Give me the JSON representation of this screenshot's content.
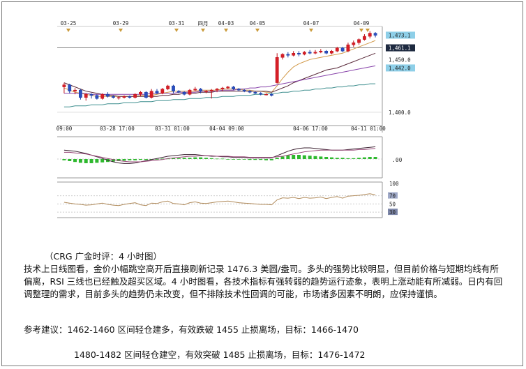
{
  "chart_data": {
    "type": "candlestick",
    "top_axis_labels": [
      "03-25",
      "03-29",
      "03-31",
      "四月",
      "04-03",
      "04-05",
      "04-07",
      "04-09"
    ],
    "bottom_axis_labels": [
      "09:00",
      "03-28 17:00",
      "03-31 01:00",
      "04-04 09:00",
      "04-06 17:00",
      "04-11 01:00"
    ],
    "price_ticks": [
      "1,473.1",
      "1,461.1",
      "1,450.0",
      "1,442.0",
      "1,400.0"
    ],
    "price_badge_colors": [
      "#8ecfe8",
      "#1e2a40",
      "#ffffff",
      "#8ecfe8"
    ],
    "ylim": [
      1390,
      1480
    ],
    "candles": [
      {
        "o": 1424,
        "h": 1428,
        "l": 1418,
        "c": 1426
      },
      {
        "o": 1426,
        "h": 1427,
        "l": 1418,
        "c": 1420
      },
      {
        "o": 1420,
        "h": 1423,
        "l": 1417,
        "c": 1421
      },
      {
        "o": 1421,
        "h": 1422,
        "l": 1412,
        "c": 1414
      },
      {
        "o": 1414,
        "h": 1418,
        "l": 1411,
        "c": 1417
      },
      {
        "o": 1417,
        "h": 1418,
        "l": 1413,
        "c": 1416
      },
      {
        "o": 1416,
        "h": 1417,
        "l": 1412,
        "c": 1413
      },
      {
        "o": 1413,
        "h": 1418,
        "l": 1412,
        "c": 1417
      },
      {
        "o": 1417,
        "h": 1419,
        "l": 1414,
        "c": 1415
      },
      {
        "o": 1415,
        "h": 1416,
        "l": 1413,
        "c": 1414
      },
      {
        "o": 1414,
        "h": 1415,
        "l": 1412,
        "c": 1414
      },
      {
        "o": 1414,
        "h": 1416,
        "l": 1413,
        "c": 1415
      },
      {
        "o": 1415,
        "h": 1416,
        "l": 1413,
        "c": 1414
      },
      {
        "o": 1414,
        "h": 1418,
        "l": 1413,
        "c": 1417
      },
      {
        "o": 1417,
        "h": 1420,
        "l": 1415,
        "c": 1419
      },
      {
        "o": 1419,
        "h": 1420,
        "l": 1413,
        "c": 1414
      },
      {
        "o": 1414,
        "h": 1422,
        "l": 1413,
        "c": 1420
      },
      {
        "o": 1420,
        "h": 1422,
        "l": 1417,
        "c": 1418
      },
      {
        "o": 1418,
        "h": 1423,
        "l": 1417,
        "c": 1422
      },
      {
        "o": 1422,
        "h": 1426,
        "l": 1421,
        "c": 1425
      },
      {
        "o": 1425,
        "h": 1426,
        "l": 1418,
        "c": 1420
      },
      {
        "o": 1420,
        "h": 1421,
        "l": 1418,
        "c": 1419
      },
      {
        "o": 1419,
        "h": 1420,
        "l": 1416,
        "c": 1417
      },
      {
        "o": 1417,
        "h": 1422,
        "l": 1416,
        "c": 1421
      },
      {
        "o": 1421,
        "h": 1424,
        "l": 1420,
        "c": 1422
      },
      {
        "o": 1422,
        "h": 1423,
        "l": 1418,
        "c": 1420
      },
      {
        "o": 1420,
        "h": 1421,
        "l": 1418,
        "c": 1420
      },
      {
        "o": 1420,
        "h": 1422,
        "l": 1413,
        "c": 1421
      },
      {
        "o": 1421,
        "h": 1423,
        "l": 1419,
        "c": 1422
      },
      {
        "o": 1422,
        "h": 1424,
        "l": 1420,
        "c": 1423
      },
      {
        "o": 1423,
        "h": 1425,
        "l": 1422,
        "c": 1424
      },
      {
        "o": 1424,
        "h": 1425,
        "l": 1421,
        "c": 1422
      },
      {
        "o": 1422,
        "h": 1423,
        "l": 1420,
        "c": 1421
      },
      {
        "o": 1421,
        "h": 1422,
        "l": 1419,
        "c": 1420
      },
      {
        "o": 1420,
        "h": 1421,
        "l": 1418,
        "c": 1419
      },
      {
        "o": 1419,
        "h": 1420,
        "l": 1417,
        "c": 1418
      },
      {
        "o": 1418,
        "h": 1419,
        "l": 1416,
        "c": 1417
      },
      {
        "o": 1417,
        "h": 1418,
        "l": 1416,
        "c": 1417
      },
      {
        "o": 1417,
        "h": 1418,
        "l": 1415,
        "c": 1416
      },
      {
        "o": 1428,
        "h": 1456,
        "l": 1427,
        "c": 1452
      },
      {
        "o": 1452,
        "h": 1456,
        "l": 1450,
        "c": 1455
      },
      {
        "o": 1455,
        "h": 1457,
        "l": 1452,
        "c": 1454
      },
      {
        "o": 1454,
        "h": 1458,
        "l": 1453,
        "c": 1456
      },
      {
        "o": 1456,
        "h": 1458,
        "l": 1453,
        "c": 1455
      },
      {
        "o": 1455,
        "h": 1458,
        "l": 1454,
        "c": 1457
      },
      {
        "o": 1457,
        "h": 1459,
        "l": 1455,
        "c": 1456
      },
      {
        "o": 1456,
        "h": 1459,
        "l": 1455,
        "c": 1457
      },
      {
        "o": 1457,
        "h": 1460,
        "l": 1456,
        "c": 1458
      },
      {
        "o": 1458,
        "h": 1459,
        "l": 1455,
        "c": 1456
      },
      {
        "o": 1456,
        "h": 1459,
        "l": 1455,
        "c": 1458
      },
      {
        "o": 1458,
        "h": 1462,
        "l": 1457,
        "c": 1461
      },
      {
        "o": 1461,
        "h": 1462,
        "l": 1457,
        "c": 1458
      },
      {
        "o": 1458,
        "h": 1466,
        "l": 1457,
        "c": 1464
      },
      {
        "o": 1464,
        "h": 1468,
        "l": 1462,
        "c": 1466
      },
      {
        "o": 1466,
        "h": 1470,
        "l": 1464,
        "c": 1469
      },
      {
        "o": 1469,
        "h": 1474,
        "l": 1468,
        "c": 1472
      },
      {
        "o": 1472,
        "h": 1477,
        "l": 1470,
        "c": 1475
      },
      {
        "o": 1475,
        "h": 1476,
        "l": 1471,
        "c": 1473
      }
    ],
    "ma_series": [
      {
        "color": "#d29a4a",
        "values": [
          1423,
          1421,
          1419,
          1418,
          1417,
          1416,
          1415,
          1415,
          1415,
          1415,
          1415,
          1415,
          1415,
          1415,
          1416,
          1416,
          1416,
          1417,
          1418,
          1419,
          1420,
          1420,
          1420,
          1420,
          1420,
          1421,
          1421,
          1421,
          1421,
          1422,
          1422,
          1422,
          1422,
          1421,
          1421,
          1420,
          1420,
          1419,
          1419,
          1425,
          1432,
          1438,
          1443,
          1446,
          1448,
          1450,
          1451,
          1452,
          1453,
          1454,
          1455,
          1456,
          1458,
          1460,
          1462,
          1464,
          1466,
          1468
        ]
      },
      {
        "color": "#5a2a3a",
        "values": [
          1428,
          1426,
          1424,
          1422,
          1420,
          1419,
          1418,
          1417,
          1416,
          1416,
          1415,
          1415,
          1415,
          1415,
          1415,
          1415,
          1415,
          1415,
          1416,
          1416,
          1417,
          1417,
          1418,
          1418,
          1418,
          1419,
          1419,
          1419,
          1420,
          1420,
          1420,
          1420,
          1420,
          1420,
          1420,
          1420,
          1420,
          1420,
          1419,
          1421,
          1423,
          1425,
          1428,
          1430,
          1432,
          1434,
          1436,
          1438,
          1440,
          1441,
          1442,
          1444,
          1446,
          1448,
          1450,
          1452,
          1454,
          1456
        ]
      },
      {
        "color": "#8844aa",
        "values": [
          1418,
          1418,
          1418,
          1418,
          1418,
          1417,
          1417,
          1417,
          1417,
          1417,
          1417,
          1417,
          1417,
          1417,
          1417,
          1417,
          1418,
          1418,
          1418,
          1418,
          1418,
          1419,
          1419,
          1419,
          1419,
          1420,
          1420,
          1420,
          1420,
          1421,
          1421,
          1421,
          1422,
          1422,
          1423,
          1423,
          1424,
          1424,
          1425,
          1426,
          1427,
          1428,
          1429,
          1430,
          1431,
          1432,
          1433,
          1434,
          1435,
          1436,
          1437,
          1438,
          1439,
          1440,
          1441,
          1442,
          1443,
          1444
        ]
      },
      {
        "color": "#3f8f8f",
        "values": [
          1405,
          1405,
          1406,
          1406,
          1406,
          1407,
          1407,
          1407,
          1408,
          1408,
          1408,
          1409,
          1409,
          1409,
          1410,
          1410,
          1410,
          1411,
          1411,
          1411,
          1412,
          1412,
          1412,
          1413,
          1413,
          1413,
          1414,
          1414,
          1414,
          1415,
          1415,
          1415,
          1416,
          1416,
          1416,
          1417,
          1417,
          1417,
          1418,
          1418,
          1419,
          1419,
          1420,
          1420,
          1421,
          1421,
          1422,
          1422,
          1423,
          1423,
          1424,
          1424,
          1425,
          1425,
          1426,
          1426,
          1427,
          1427
        ]
      }
    ],
    "macd_tick": ".00",
    "macd_hist": [
      -0.3,
      -0.5,
      -0.7,
      -0.9,
      -1.0,
      -1.0,
      -0.9,
      -0.8,
      -0.7,
      -0.6,
      -0.5,
      -0.4,
      -0.3,
      -0.3,
      -0.2,
      -0.2,
      -0.1,
      0.0,
      0.1,
      0.1,
      0.2,
      0.2,
      0.3,
      0.3,
      0.4,
      0.4,
      0.3,
      0.2,
      0.1,
      0.1,
      0.0,
      -0.1,
      -0.1,
      -0.1,
      -0.2,
      -0.2,
      -0.2,
      -0.3,
      -0.3,
      0.3,
      0.6,
      0.9,
      1.0,
      1.0,
      0.9,
      0.8,
      0.7,
      0.6,
      0.5,
      0.4,
      0.3,
      0.3,
      0.2,
      0.2,
      0.3,
      0.4,
      0.5,
      0.5
    ],
    "macd_lines": [
      {
        "color": "#3a2030",
        "values": [
          1.6,
          1.5,
          1.4,
          1.2,
          1.0,
          0.7,
          0.4,
          0.1,
          -0.2,
          -0.5,
          -0.7,
          -0.8,
          -0.8,
          -0.7,
          -0.5,
          -0.3,
          -0.1,
          0.1,
          0.3,
          0.5,
          0.6,
          0.7,
          0.8,
          0.8,
          0.8,
          0.7,
          0.6,
          0.5,
          0.5,
          0.4,
          0.4,
          0.3,
          0.3,
          0.3,
          0.2,
          0.2,
          0.2,
          0.2,
          0.2,
          0.6,
          1.0,
          1.4,
          1.7,
          1.9,
          2.0,
          2.0,
          1.9,
          1.8,
          1.7,
          1.6,
          1.6,
          1.6,
          1.7,
          1.8,
          1.9,
          2.0,
          2.1,
          2.2
        ]
      },
      {
        "color": "#9a4a7a",
        "values": [
          1.2,
          1.2,
          1.1,
          1.0,
          0.9,
          0.7,
          0.5,
          0.3,
          0.1,
          -0.1,
          -0.3,
          -0.4,
          -0.5,
          -0.5,
          -0.5,
          -0.4,
          -0.3,
          -0.2,
          -0.1,
          0.1,
          0.2,
          0.3,
          0.4,
          0.5,
          0.5,
          0.6,
          0.6,
          0.6,
          0.5,
          0.5,
          0.5,
          0.4,
          0.4,
          0.4,
          0.3,
          0.3,
          0.3,
          0.3,
          0.3,
          0.4,
          0.5,
          0.7,
          0.9,
          1.1,
          1.3,
          1.4,
          1.5,
          1.6,
          1.6,
          1.6,
          1.6,
          1.6,
          1.6,
          1.6,
          1.7,
          1.7,
          1.8,
          1.9
        ]
      }
    ],
    "rsi_ticks": [
      "100",
      "70",
      "50",
      "30"
    ],
    "rsi": [
      54,
      52,
      50,
      49,
      47,
      48,
      50,
      52,
      49,
      47,
      46,
      49,
      51,
      53,
      48,
      46,
      52,
      51,
      55,
      57,
      51,
      50,
      48,
      53,
      55,
      52,
      51,
      53,
      55,
      56,
      57,
      55,
      53,
      52,
      51,
      50,
      49,
      49,
      48,
      60,
      65,
      64,
      66,
      63,
      66,
      64,
      65,
      67,
      63,
      66,
      68,
      64,
      69,
      70,
      71,
      73,
      75,
      72
    ]
  },
  "text": {
    "caption": "（CRG 广金时评：4 小时图）",
    "body": "技术上日线图看，金价小幅跳空高开后直接刷新记录 1476.3 美圆/盎司。多头的强势比较明显，但目前价格与短期均线有所偏离，RSI 三线也已经触及超买区域。4 小时图看，各技术指标有强转弱的趋势运行迹象，表明上涨动能有所减弱。日内有回调整理的需求，目前多头的趋势仍未改变，但不排除技术性回调的可能，市场诸多因素不明朗，应保持谨慎。",
    "suggestion1": "参考建议：1462-1460 区间轻仓建多，有效跌破 1455 止损离场，目标：1466-1470",
    "suggestion2": "1480-1482 区间轻仓建空，有效突破 1485 止损离场，目标：1476-1472"
  }
}
